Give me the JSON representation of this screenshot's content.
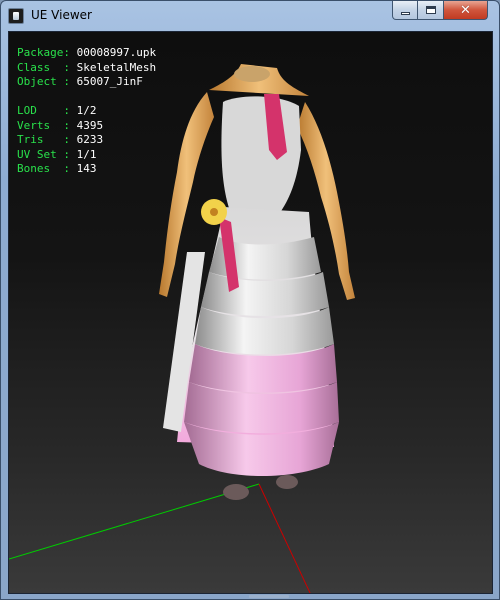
{
  "window": {
    "title": "UE Viewer",
    "app_icon": "ue-viewer-app-icon",
    "controls": {
      "minimize_icon": "minimize-icon",
      "maximize_icon": "maximize-icon",
      "close_icon": "close-icon",
      "close_glyph": "✕",
      "close_color": "#c13a22"
    }
  },
  "info": {
    "package_key": "Package:",
    "package_value": "00008997.upk",
    "class_key": "Class  :",
    "class_value": "SkeletalMesh",
    "object_key": "Object :",
    "object_value": "65007_JinF",
    "lod_key": "LOD    :",
    "lod_value": "1/2",
    "verts_key": "Verts  :",
    "verts_value": "4395",
    "tris_key": "Tris   :",
    "tris_value": "6233",
    "uvset_key": "UV Set :",
    "uvset_value": "1/1",
    "bones_key": "Bones  :",
    "bones_value": "143",
    "key_color": "#29e14b",
    "value_color": "#ffffff"
  },
  "axes": {
    "x_axis_color": "#cc0000",
    "y_axis_color": "#00cc00"
  }
}
